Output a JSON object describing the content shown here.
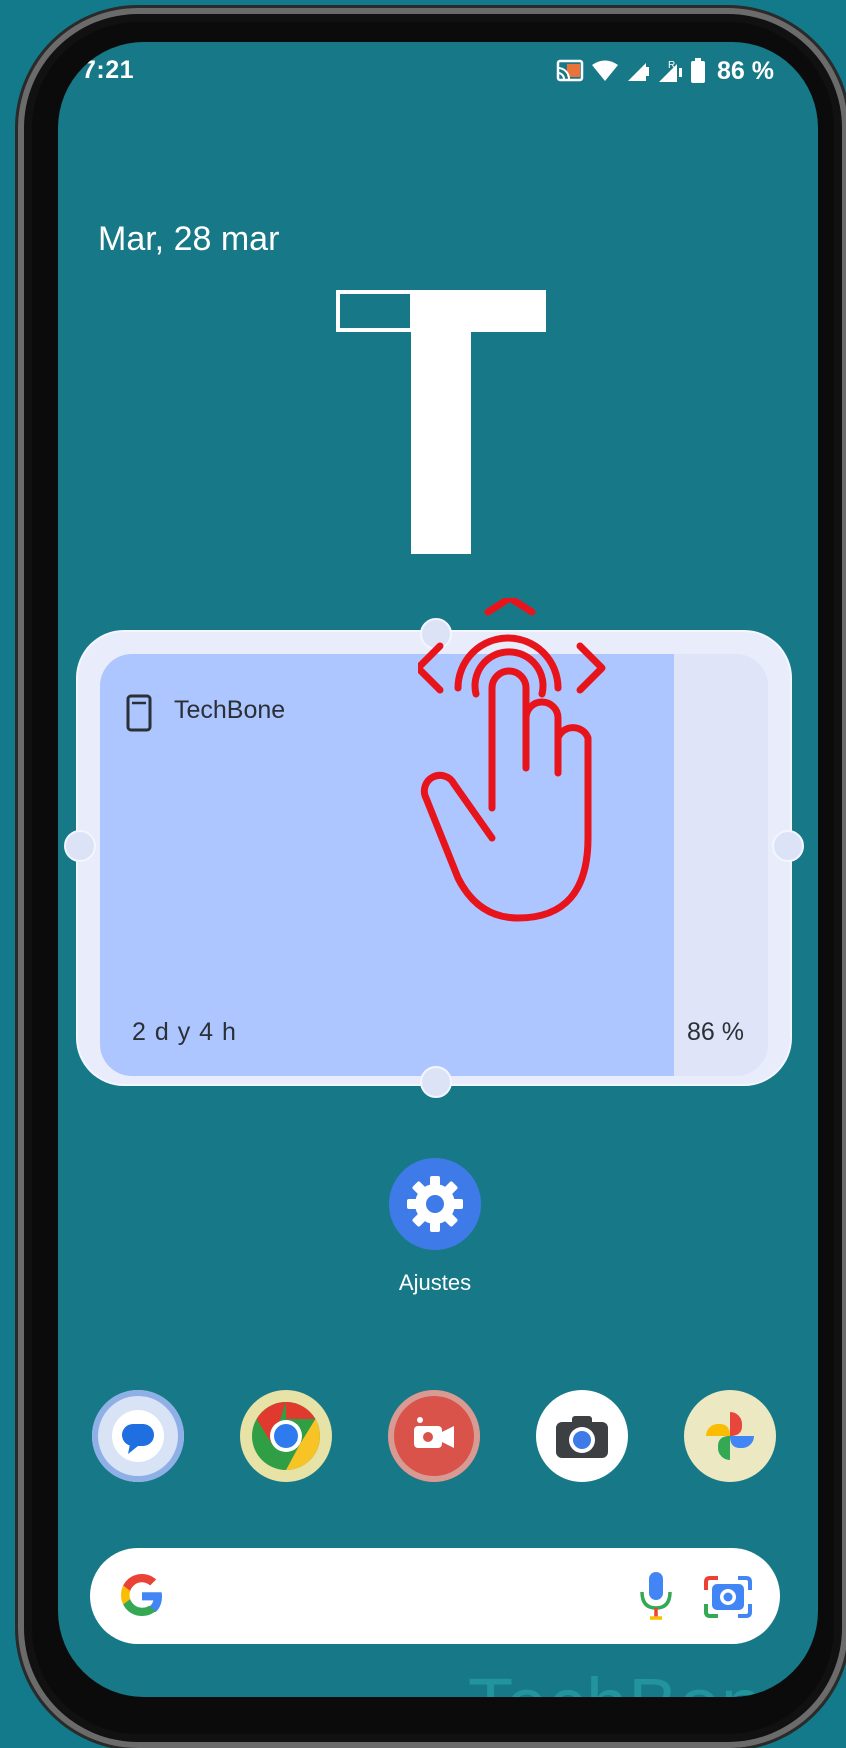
{
  "status_bar": {
    "time": "7:21",
    "battery_percent": "86 %",
    "icons": [
      "cast-icon",
      "wifi-icon",
      "signal-icon",
      "signal-roaming-icon",
      "battery-icon"
    ]
  },
  "home": {
    "date": "Mar, 28 mar",
    "clock_glyph": "T"
  },
  "battery_widget": {
    "device_name": "TechBone",
    "remaining_time": "2 d y 4 h",
    "battery_percent": "86 %",
    "battery_level": 0.86,
    "fill_color": "#adc6ff"
  },
  "apps": {
    "settings_label": "Ajustes"
  },
  "dock": {
    "apps": [
      "messages-icon",
      "chrome-icon",
      "screen-recorder-icon",
      "camera-icon",
      "photos-icon"
    ]
  },
  "search": {
    "placeholder": ""
  },
  "watermark": "TechBone",
  "colors": {
    "wallpaper": "#177988",
    "accent": "#3f7be8",
    "gesture": "#e8141c"
  }
}
